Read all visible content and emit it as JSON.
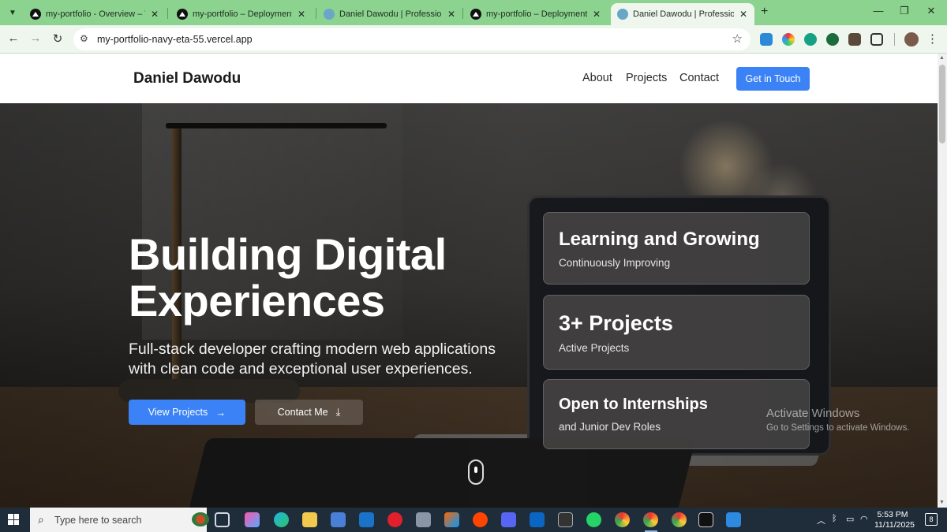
{
  "browser": {
    "tabs": [
      {
        "title": "my-portfolio - Overview – Vercel",
        "favicon": "vercel-icon"
      },
      {
        "title": "my-portfolio – Deployment Overview",
        "favicon": "vercel-icon"
      },
      {
        "title": "Daniel Dawodu | Professional Web Developer",
        "favicon": "globe-icon"
      },
      {
        "title": "my-portfolio – Deployment Overview",
        "favicon": "vercel-icon"
      },
      {
        "title": "Daniel Dawodu | Professional Web Developer",
        "favicon": "globe-icon",
        "active": true
      }
    ],
    "new_tab": "+",
    "url": "my-portfolio-navy-eta-55.vercel.app"
  },
  "site": {
    "brand": "Daniel Dawodu",
    "nav": {
      "about": "About",
      "projects": "Projects",
      "contact": "Contact",
      "cta": "Get in Touch"
    }
  },
  "hero": {
    "title_line1": "Building Digital",
    "title_line2": "Experiences",
    "subtitle": "Full-stack developer crafting modern web applications with clean code and exceptional user experiences.",
    "primary_button": "View Projects",
    "secondary_button": "Contact Me"
  },
  "stats": [
    {
      "title": "Learning and Growing",
      "subtitle": "Continuously Improving"
    },
    {
      "title": "3+ Projects",
      "subtitle": "Active Projects"
    },
    {
      "title": "Open to Internships",
      "subtitle": "and Junior Dev Roles"
    }
  ],
  "watermark": {
    "title": "Activate Windows",
    "subtitle": "Go to Settings to activate Windows."
  },
  "taskbar": {
    "search_placeholder": "Type here to search",
    "time": "5:53 PM",
    "date": "11/11/2025",
    "notification_count": "8"
  },
  "colors": {
    "accent": "#3b82f6",
    "tabstrip": "#8bd38e",
    "taskbar": "#1f2c3a"
  }
}
